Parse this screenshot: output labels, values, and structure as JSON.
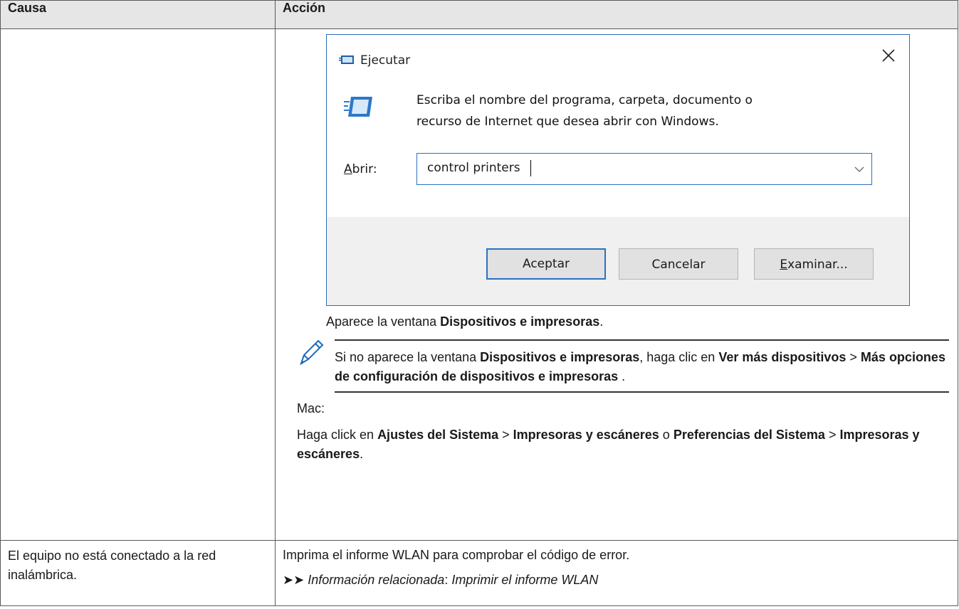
{
  "table": {
    "header_cause": "Causa",
    "header_action": "Acción"
  },
  "run_dialog": {
    "title": "Ejecutar",
    "description_line1": "Escriba el nombre del programa, carpeta, documento o",
    "description_line2": "recurso de Internet que desea abrir con Windows.",
    "open_label_mnemonic": "A",
    "open_label_rest": "brir:",
    "input_value": "control printers",
    "ok_button": "Aceptar",
    "cancel_button": "Cancelar",
    "browse_button_mnemonic": "E",
    "browse_button_rest": "xaminar...",
    "title_icon": "run-icon",
    "close_icon": "close-icon",
    "dropdown_icon": "chevron-down-icon"
  },
  "row1": {
    "appears_prefix": "Aparece la ventana ",
    "appears_bold": "Dispositivos e impresoras",
    "appears_suffix": ".",
    "note": {
      "icon": "pencil-icon",
      "t1": "Si no aparece la ventana ",
      "b1": "Dispositivos e impresoras",
      "t2": ", haga clic en ",
      "b2": "Ver más dispositivos",
      "t3": " > ",
      "b3": "Más opciones de configuración de dispositivos e impresoras",
      "t4": " ."
    },
    "mac_label": "Mac:",
    "mac_instr": {
      "t1": "Haga click en ",
      "b1": "Ajustes del Sistema",
      "t2": " > ",
      "b2": "Impresoras y escáneres",
      "t3": " o ",
      "b3": "Preferencias del Sistema",
      "t4": " > ",
      "b4": "Impresoras y escáneres",
      "t5": "."
    }
  },
  "row2": {
    "cause": "El equipo no está conectado a la red inalámbrica.",
    "action": "Imprima el informe WLAN para comprobar el código de error.",
    "related_arrows": "➤➤",
    "related_label": "Información relacionada",
    "related_sep": ": ",
    "related_link": "Imprimir el informe WLAN"
  }
}
